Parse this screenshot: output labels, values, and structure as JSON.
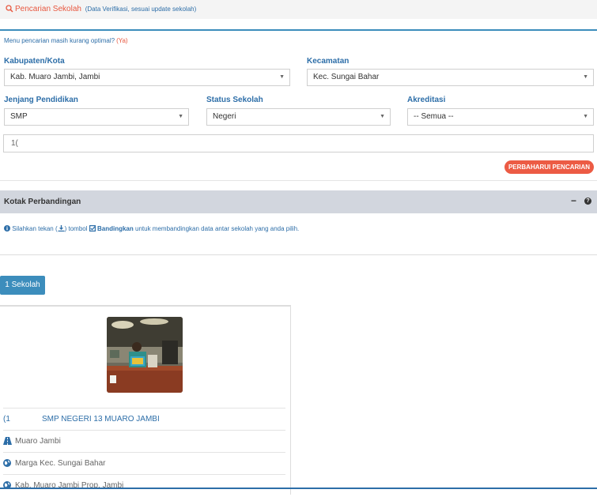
{
  "header": {
    "title": "Pencarian Sekolah",
    "subtitle": "(Data Verifikasi, sesuai update sekolah)"
  },
  "hint": {
    "text": "Menu pencarian masih kurang optimal?",
    "link": "(Ya)"
  },
  "filters": {
    "kabupaten": {
      "label": "Kabupaten/Kota",
      "value": "Kab. Muaro Jambi, Jambi"
    },
    "kecamatan": {
      "label": "Kecamatan",
      "value": "Kec. Sungai Bahar"
    },
    "jenjang": {
      "label": "Jenjang Pendidikan",
      "value": "SMP"
    },
    "status": {
      "label": "Status Sekolah",
      "value": "Negeri"
    },
    "akreditasi": {
      "label": "Akreditasi",
      "value": "-- Semua --"
    },
    "search_value": "1("
  },
  "buttons": {
    "refresh": "PERBAHARUI PENCARIAN",
    "count": "1 Sekolah"
  },
  "compare_box": {
    "title": "Kotak Perbandingan",
    "minimize": "−",
    "help": "?",
    "info_pre": "Silahkan tekan (",
    "info_mid": ") tombol",
    "info_bold": "Bandingkan",
    "info_post": "untuk membandingkan data antar sekolah yang anda pilih."
  },
  "school": {
    "npsn": "(1",
    "name": "SMP NEGERI 13 MUARO JAMBI",
    "road": "Muaro Jambi",
    "district": "Marga Kec. Sungai Bahar",
    "region": "Kab. Muaro Jambi Prop. Jambi"
  },
  "icons": {
    "search": "search-icon",
    "info": "info-icon",
    "download": "download-icon",
    "checkbox": "check-square-icon",
    "road": "road-icon",
    "globe": "globe-icon"
  },
  "colors": {
    "accent": "#3c8dbc",
    "link": "#2d6ea8",
    "danger": "#ec5b44",
    "box_header": "#d2d6de"
  }
}
